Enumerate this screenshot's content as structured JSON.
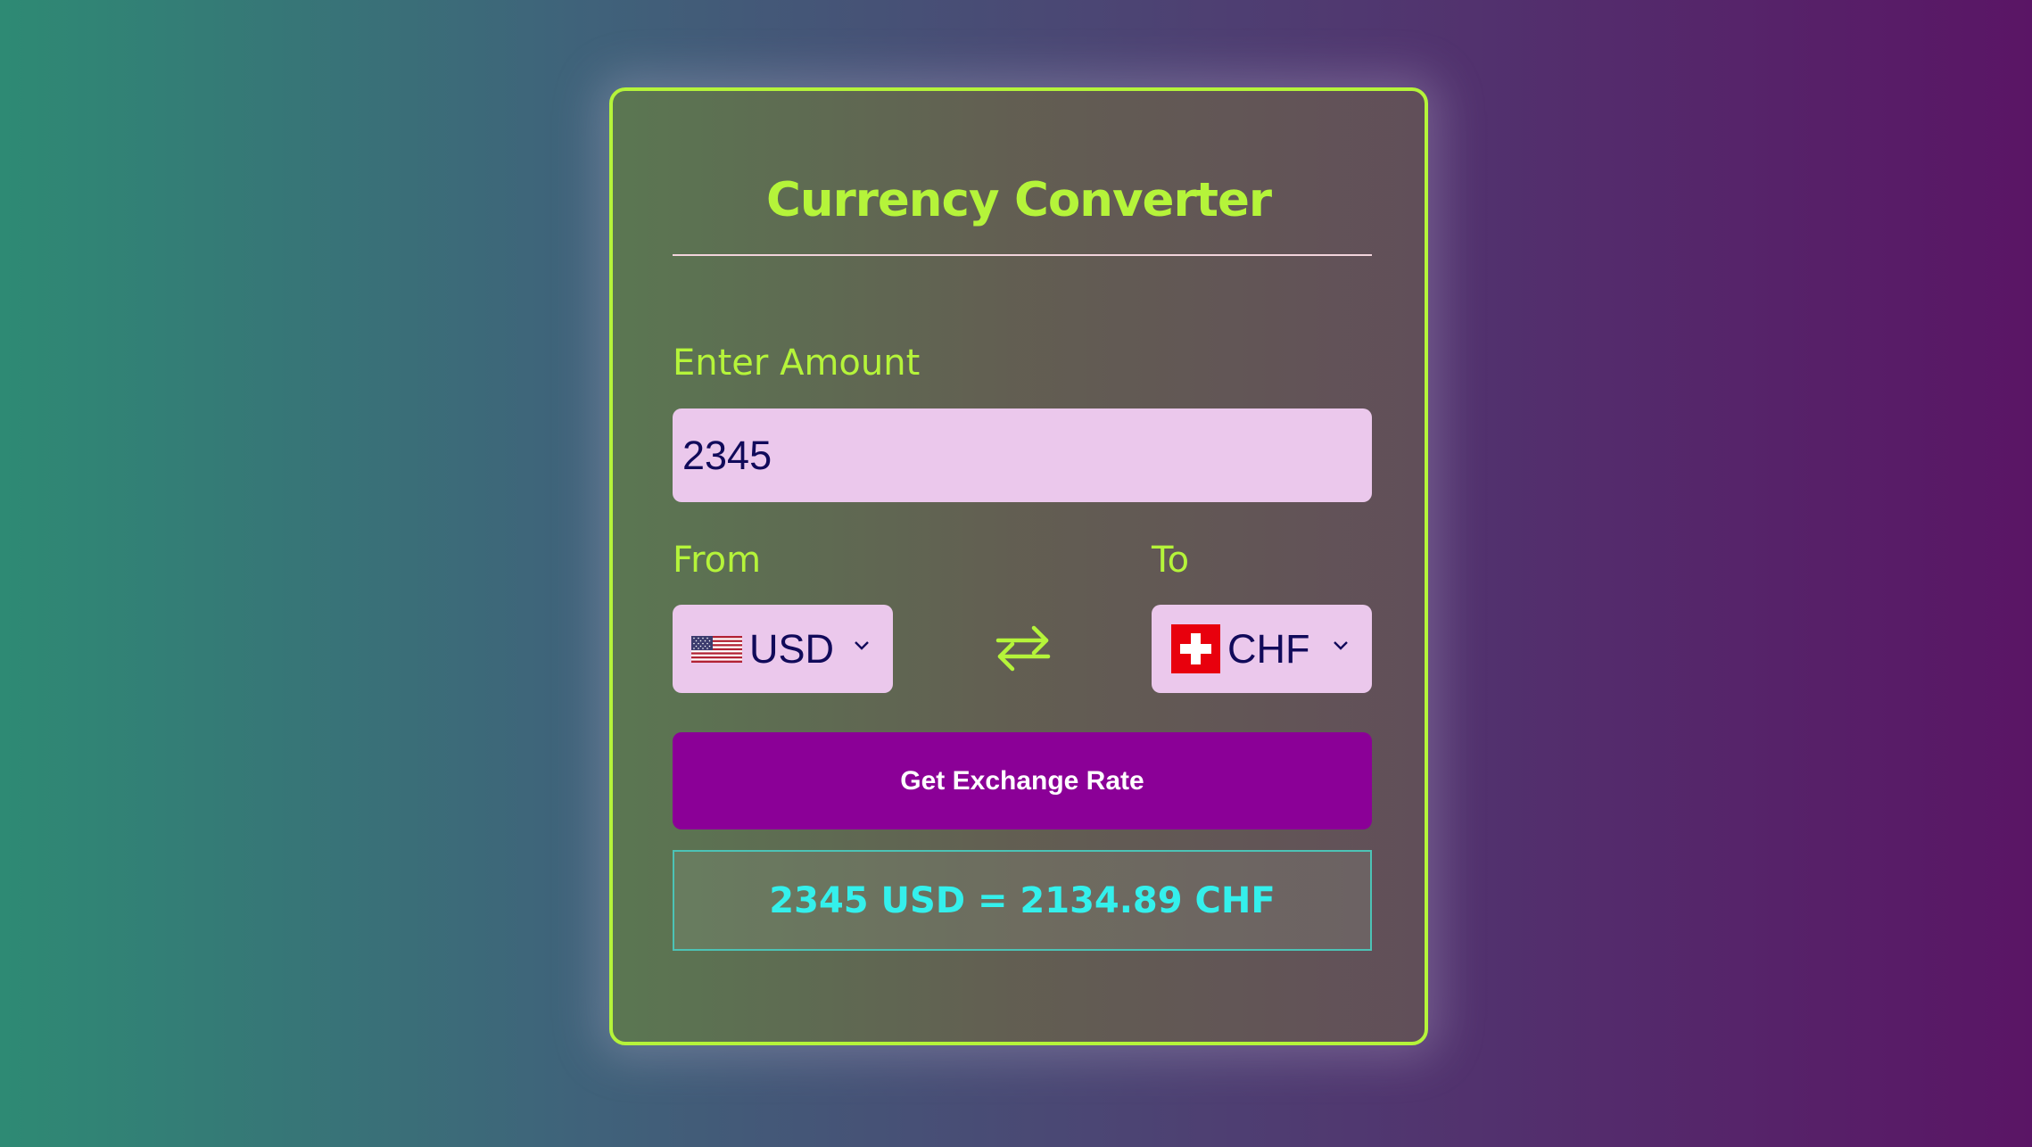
{
  "app": {
    "title": "Currency Converter"
  },
  "amount": {
    "label": "Enter Amount",
    "value": "2345"
  },
  "from": {
    "label": "From",
    "currency": "USD",
    "flag_icon": "us-flag-icon"
  },
  "to": {
    "label": "To",
    "currency": "CHF",
    "flag_icon": "switzerland-flag-icon"
  },
  "swap": {
    "icon": "swap-arrows-icon"
  },
  "button": {
    "label": "Get Exchange Rate"
  },
  "result": {
    "text": "2345 USD = 2134.89 CHF"
  },
  "colors": {
    "accent": "#b5f43a",
    "button": "#8b0097",
    "input_bg": "#ebc8ec",
    "text_dark": "#110a5a",
    "result_text": "#34f0ec"
  }
}
